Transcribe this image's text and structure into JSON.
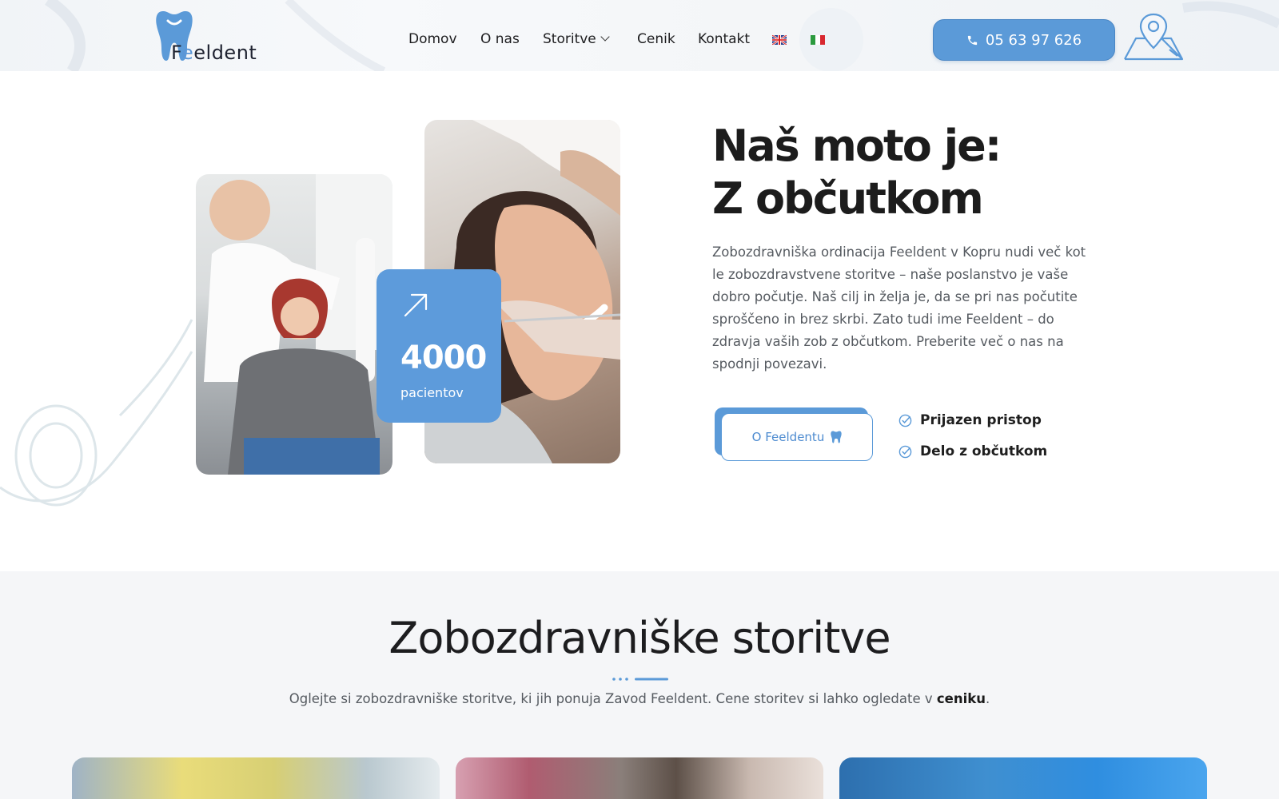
{
  "brand": {
    "name_prefix": "F",
    "name_o": "e",
    "name_suffix": "eldent",
    "accent": "#5b9ad8"
  },
  "nav": {
    "items": [
      {
        "label": "Domov"
      },
      {
        "label": "O nas"
      },
      {
        "label": "Storitve"
      },
      {
        "label": "Cenik"
      },
      {
        "label": "Kontakt"
      }
    ],
    "languages": [
      "english-flag-icon",
      "italian-flag-icon"
    ]
  },
  "header": {
    "phone": "05 63 97 626",
    "icons": [
      "phone-icon",
      "map-pin-icon"
    ]
  },
  "hero": {
    "title_line1": "Naš moto je:",
    "title_line2": "Z občutkom",
    "text": "Zobozdravniška ordinacija Feeldent v Kopru nudi več kot le zobozdravstvene storitve – naše poslanstvo je vaše dobro počutje. Naš cilj in želja je, da se pri nas počutite sproščeno in brez skrbi. Zato tudi ime Feeldent – do zdravja vaših zob z občutkom. Preberite več o nas na spodnji povezavi.",
    "stat": {
      "value": "4000",
      "label": "pacientov"
    },
    "button_label": "O Feeldentu",
    "checks": [
      "Prijazen pristop",
      "Delo z občutkom"
    ]
  },
  "services": {
    "title": "Zobozdravniške storitve",
    "subtitle_prefix": "Oglejte si zobozdravniške storitve, ki jih ponuja Zavod Feeldent. Cene storitev si lahko ogledate v ",
    "subtitle_link": "ceniku",
    "subtitle_suffix": "."
  }
}
